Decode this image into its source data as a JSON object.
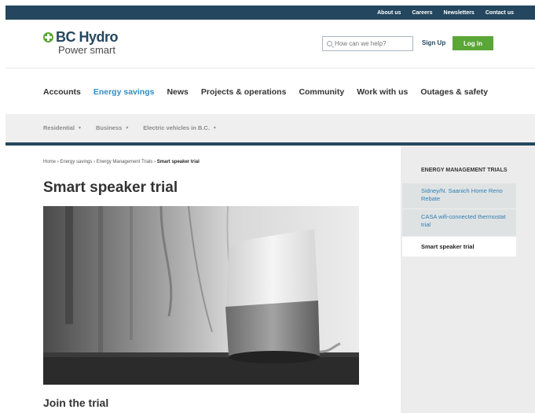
{
  "utility_nav": {
    "links": [
      "About us",
      "Careers",
      "Newsletters",
      "Contact us"
    ]
  },
  "header": {
    "brand_name": "BC Hydro",
    "brand_tagline": "Power smart",
    "search_placeholder": "How can we help?",
    "signup_label": "Sign Up",
    "login_label": "Log in"
  },
  "main_nav": {
    "items": [
      "Accounts",
      "Energy savings",
      "News",
      "Projects & operations",
      "Community",
      "Work with us",
      "Outages & safety"
    ],
    "active": "Energy savings"
  },
  "sub_nav": {
    "items": [
      "Residential",
      "Business",
      "Electric vehicles in B.C."
    ]
  },
  "breadcrumb": [
    "Home",
    "Energy savings",
    "Energy Management Trials",
    "Smart speaker trial"
  ],
  "page": {
    "title": "Smart speaker trial",
    "section_title": "Join the trial"
  },
  "sidebar": {
    "heading": "ENERGY MANAGEMENT TRIALS",
    "items": [
      "Sidney/N. Saanich Home Reno Rebate",
      "CASA wifi-connected thermostat trial",
      "Smart speaker trial"
    ],
    "current": "Smart speaker trial"
  },
  "colors": {
    "utility_bar": "#24475f",
    "brand_green": "#5aa637",
    "nav_active": "#2e8fc5",
    "sidebar_link": "#2e7fb4"
  }
}
